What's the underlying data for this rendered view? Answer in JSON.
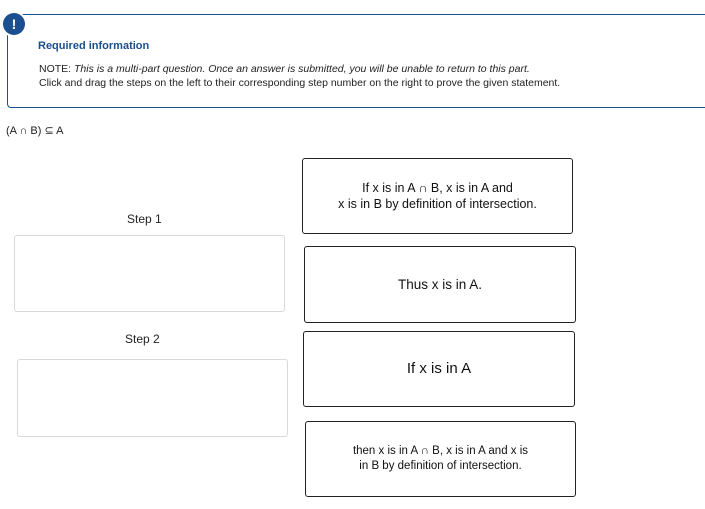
{
  "info": {
    "badge": "!",
    "title": "Required information",
    "note_prefix": "NOTE: ",
    "note_text": "This is a multi-part question. Once an answer is submitted, you will be unable to return to this part.",
    "instructions": "Click and drag the steps on the left to their corresponding step number on the right to prove the given statement."
  },
  "statement": "(A ∩ B) ⊆ A",
  "steps": [
    {
      "label": "Step 1"
    },
    {
      "label": "Step 2"
    }
  ],
  "cards": [
    {
      "line1": "If x is in A ∩ B,  x is in A and",
      "line2": "x is in B by definition of intersection."
    },
    {
      "line1": "Thus x is in A."
    },
    {
      "line1": "If x is in A"
    },
    {
      "line1": "then x is in A ∩ B, x is in A and x is",
      "line2": "in B by definition of intersection."
    }
  ]
}
